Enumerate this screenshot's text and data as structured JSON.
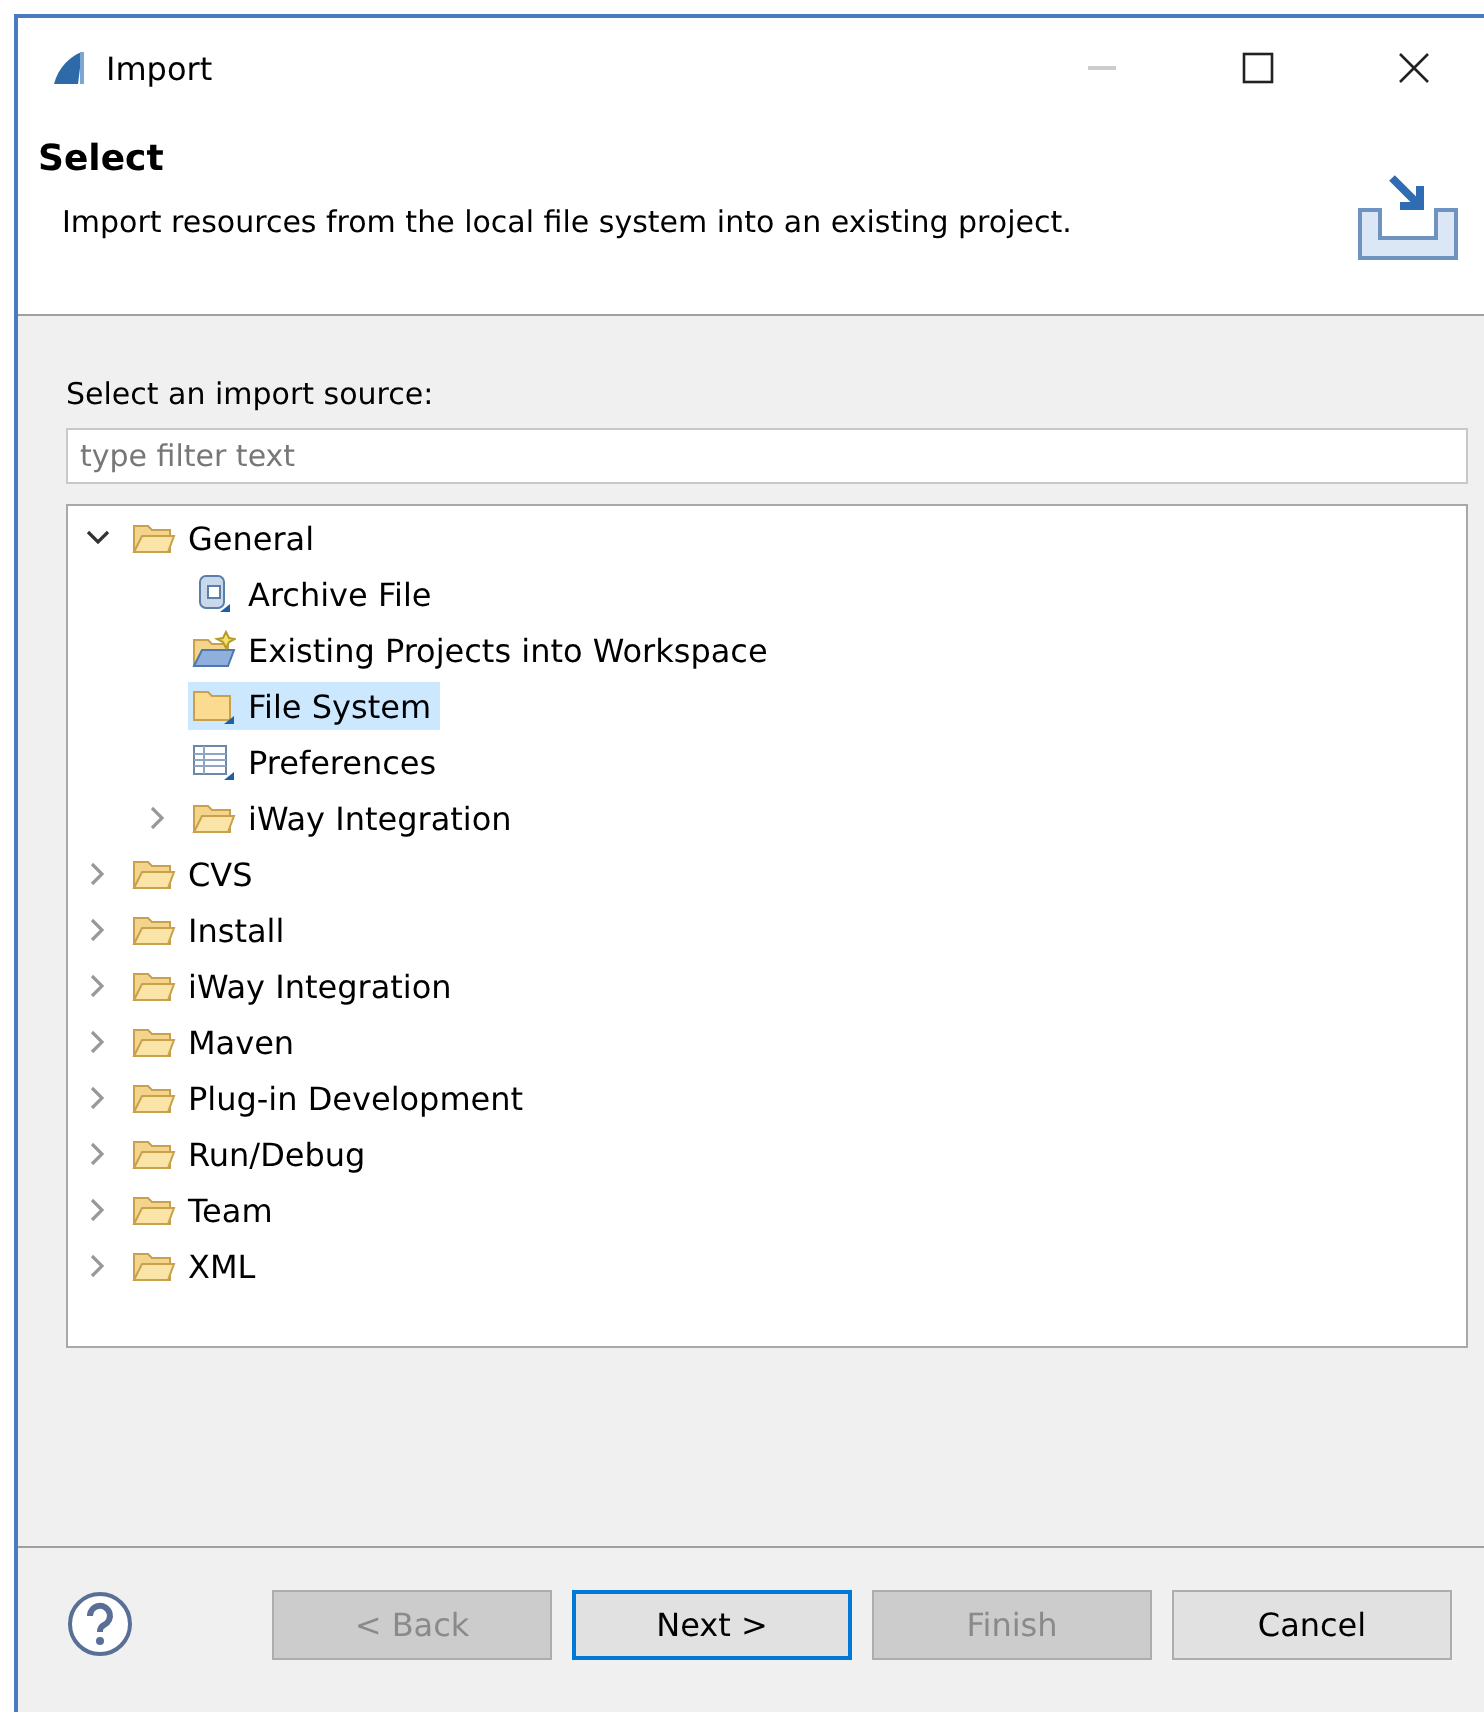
{
  "window": {
    "title": "Import"
  },
  "header": {
    "title": "Select",
    "description": "Import resources from the local file system into an existing project."
  },
  "source_label": "Select an import source:",
  "filter": {
    "placeholder": "type filter text"
  },
  "tree": [
    {
      "label": "General",
      "kind": "folder",
      "expanded": true,
      "selected": false,
      "children": [
        {
          "label": "Archive File",
          "kind": "archive",
          "selected": false
        },
        {
          "label": "Existing Projects into Workspace",
          "kind": "project",
          "selected": false
        },
        {
          "label": "File System",
          "kind": "filesystem",
          "selected": true
        },
        {
          "label": "Preferences",
          "kind": "preferences",
          "selected": false
        },
        {
          "label": "iWay Integration",
          "kind": "folder",
          "expanded": false,
          "selected": false
        }
      ]
    },
    {
      "label": "CVS",
      "kind": "folder",
      "expanded": false,
      "selected": false
    },
    {
      "label": "Install",
      "kind": "folder",
      "expanded": false,
      "selected": false
    },
    {
      "label": "iWay Integration",
      "kind": "folder",
      "expanded": false,
      "selected": false
    },
    {
      "label": "Maven",
      "kind": "folder",
      "expanded": false,
      "selected": false
    },
    {
      "label": "Plug-in Development",
      "kind": "folder",
      "expanded": false,
      "selected": false
    },
    {
      "label": "Run/Debug",
      "kind": "folder",
      "expanded": false,
      "selected": false
    },
    {
      "label": "Team",
      "kind": "folder",
      "expanded": false,
      "selected": false
    },
    {
      "label": "XML",
      "kind": "folder",
      "expanded": false,
      "selected": false
    }
  ],
  "buttons": [
    {
      "label": "< Back",
      "disabled": true,
      "default": false
    },
    {
      "label": "Next >",
      "disabled": false,
      "default": true
    },
    {
      "label": "Finish",
      "disabled": true,
      "default": false
    },
    {
      "label": "Cancel",
      "disabled": false,
      "default": false
    }
  ]
}
